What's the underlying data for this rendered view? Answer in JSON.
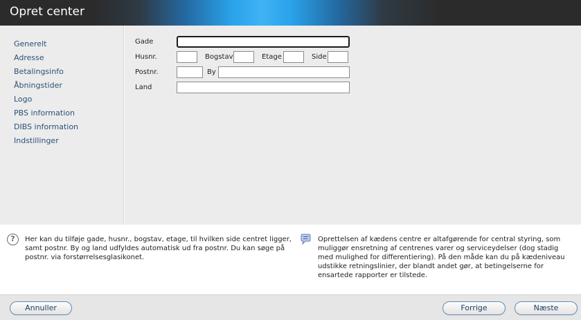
{
  "window": {
    "title": "Opret center"
  },
  "sidebar": {
    "items": [
      {
        "label": "Generelt"
      },
      {
        "label": "Adresse"
      },
      {
        "label": "Betalingsinfo"
      },
      {
        "label": "Åbningstider"
      },
      {
        "label": "Logo"
      },
      {
        "label": "PBS information"
      },
      {
        "label": "DIBS information"
      },
      {
        "label": "Indstillinger"
      }
    ]
  },
  "form": {
    "gade": {
      "label": "Gade",
      "value": ""
    },
    "husnr": {
      "label": "Husnr.",
      "value": ""
    },
    "bogstav": {
      "label": "Bogstav",
      "value": ""
    },
    "etage": {
      "label": "Etage",
      "value": ""
    },
    "side": {
      "label": "Side",
      "value": ""
    },
    "postnr": {
      "label": "Postnr.",
      "value": ""
    },
    "by": {
      "label": "By",
      "value": ""
    },
    "land": {
      "label": "Land",
      "value": ""
    }
  },
  "help": {
    "left_text": "Her kan du tilføje gade, husnr., bogstav, etage, til hvilken side centret ligger, samt postnr. By og land udfyldes automatisk ud fra postnr. Du kan søge på postnr. via forstørrelsesglasikonet.",
    "right_text": "Oprettelsen af kædens centre er altafgørende for central styring, som muliggør ensretning af centrenes varer og serviceydelser (dog stadig med mulighed for differentiering). På den måde kan du på kædeniveau udstikke retningslinier, der blandt andet gør, at betingelserne for ensartede rapporter er tilstede."
  },
  "footer": {
    "cancel_label": "Annuller",
    "prev_label": "Forrige",
    "next_label": "Næste"
  },
  "icons": {
    "help": "question-circle-icon",
    "info": "speech-bubble-icon"
  }
}
